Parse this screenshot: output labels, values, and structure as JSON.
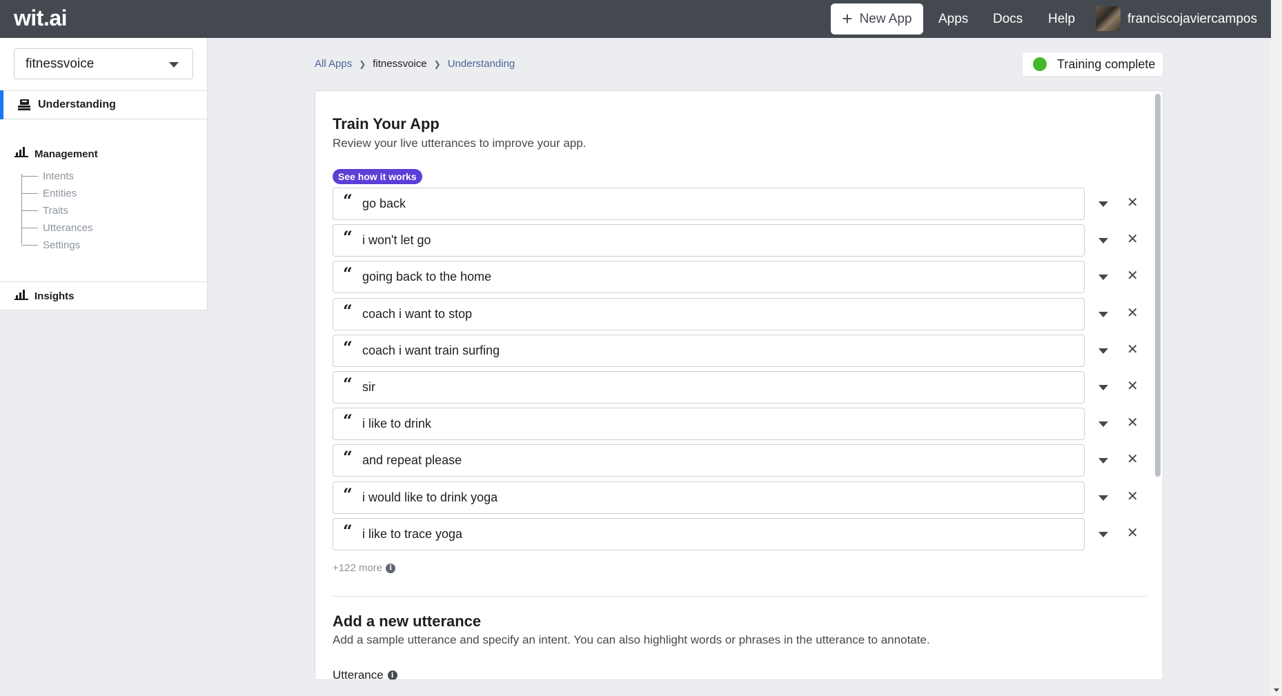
{
  "topbar": {
    "logo": "wit.ai",
    "new_app_label": "New App",
    "nav": [
      "Apps",
      "Docs",
      "Help"
    ],
    "username": "franciscojaviercampos"
  },
  "sidebar": {
    "app_selected": "fitnessvoice",
    "understanding_label": "Understanding",
    "management_label": "Management",
    "management_items": [
      "Intents",
      "Entities",
      "Traits",
      "Utterances",
      "Settings"
    ],
    "insights_label": "Insights"
  },
  "breadcrumb": {
    "all_apps": "All Apps",
    "app": "fitnessvoice",
    "current": "Understanding"
  },
  "status": {
    "training_label": "Training complete",
    "color": "#42b72a"
  },
  "train": {
    "title": "Train Your App",
    "subtitle": "Review your live utterances to improve your app.",
    "how_it_works": "See how it works",
    "utterances": [
      "go back",
      "i won't let go",
      "going back to the home",
      "coach i want to stop",
      "coach i want train surfing",
      "sir",
      "i like to drink",
      "and repeat please",
      "i would like to drink yoga",
      "i like to trace yoga"
    ],
    "more_label": "+122 more"
  },
  "add": {
    "title": "Add a new utterance",
    "subtitle": "Add a sample utterance and specify an intent. You can also highlight words or phrases in the utterance to annotate.",
    "utterance_label": "Utterance"
  },
  "icons": {
    "quote": "quote-icon",
    "info": "info-icon",
    "accent": "#5b3fd6"
  }
}
